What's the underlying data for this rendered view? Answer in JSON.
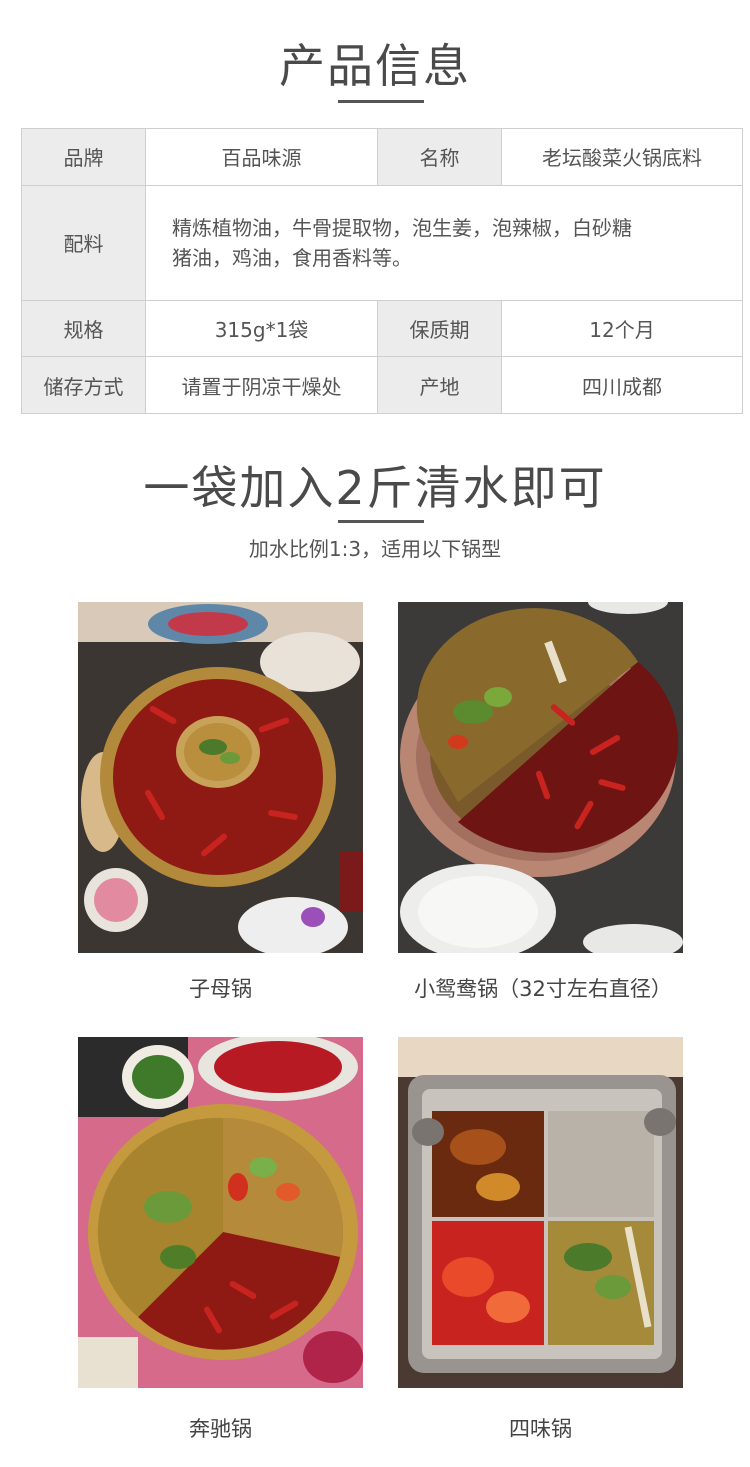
{
  "product_info": {
    "title": "产品信息",
    "rows": [
      {
        "k1": "品牌",
        "v1": "百品味源",
        "k2": "名称",
        "v2": "老坛酸菜火锅底料"
      },
      {
        "k1": "配料",
        "v1_line1": "精炼植物油，牛骨提取物，泡生姜，泡辣椒，白砂糖",
        "v1_line2": "猪油，鸡油，食用香料等。"
      },
      {
        "k1": "规格",
        "v1": "315g*1袋",
        "k2": "保质期",
        "v2": "12个月"
      },
      {
        "k1": "储存方式",
        "v1": "请置于阴凉干燥处",
        "k2": "产地",
        "v2": "四川成都"
      }
    ]
  },
  "usage": {
    "title": "一袋加入2斤清水即可",
    "subtitle": "加水比例1:3，适用以下锅型"
  },
  "pots": [
    {
      "caption": "子母锅",
      "icon": "mother-child-hotpot-photo"
    },
    {
      "caption": "小鸳鸯锅（32寸左右直径）",
      "icon": "yin-yang-hotpot-photo"
    },
    {
      "caption": "奔驰锅",
      "icon": "three-section-hotpot-photo"
    },
    {
      "caption": "四味锅",
      "icon": "four-section-hotpot-photo"
    }
  ],
  "colors": {
    "header_bg": "#ececec",
    "border": "#cfcfcf",
    "broth_red": "#8f1a14",
    "chili": "#c8231e",
    "brass": "#c09a4a",
    "copper": "#b98673"
  }
}
